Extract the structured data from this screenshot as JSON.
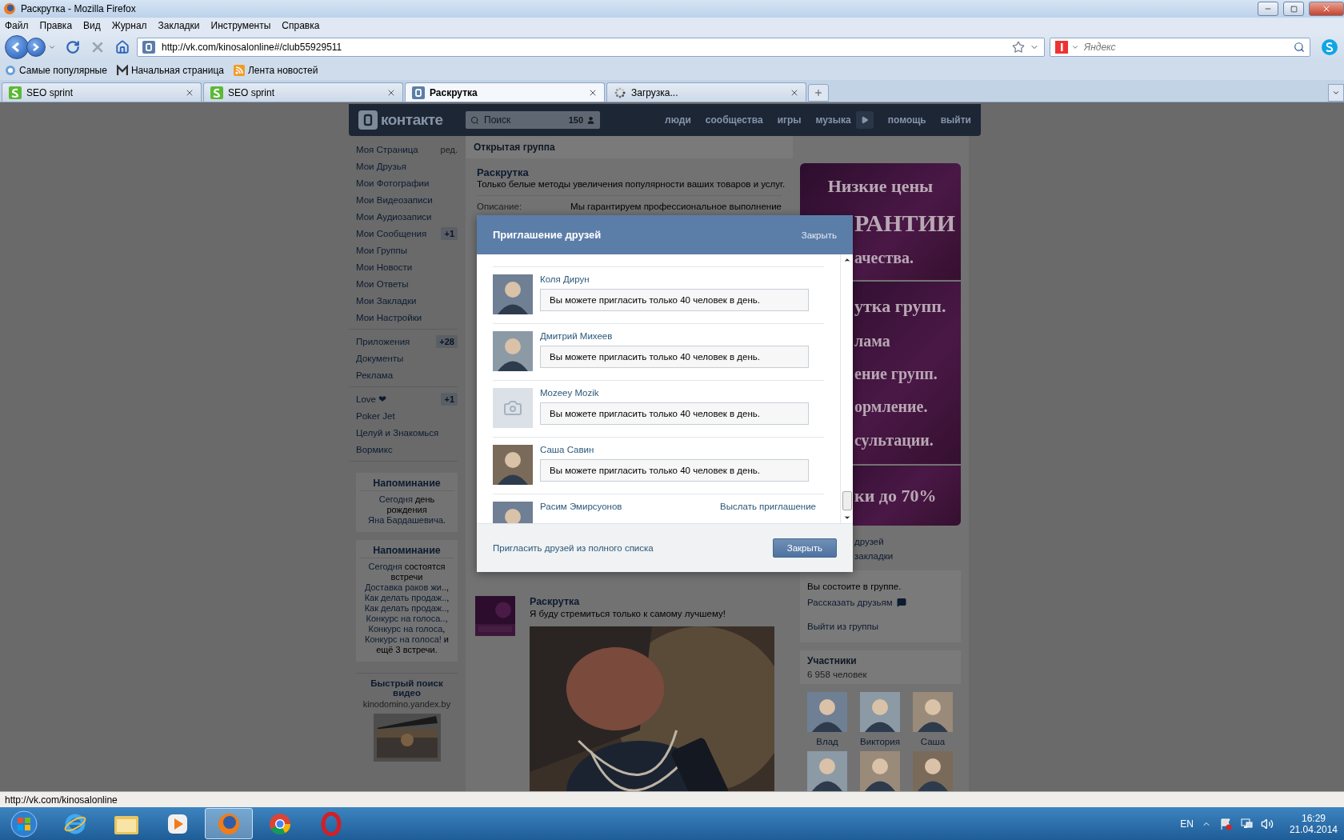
{
  "window": {
    "title": "Раскрутка - Mozilla Firefox"
  },
  "menu": [
    "Файл",
    "Правка",
    "Вид",
    "Журнал",
    "Закладки",
    "Инструменты",
    "Справка"
  ],
  "address": {
    "url": "http://vk.com/kinosalonline#/club55929511"
  },
  "search": {
    "placeholder": "Яндекс"
  },
  "bookmarks": [
    {
      "label": "Самые популярные",
      "kind": "popular"
    },
    {
      "label": "Начальная страница",
      "kind": "home"
    },
    {
      "label": "Лента новостей",
      "kind": "rss"
    }
  ],
  "tabs": [
    {
      "label": "SEO sprint",
      "kind": "seo",
      "selected": false
    },
    {
      "label": "SEO sprint",
      "kind": "seo",
      "selected": false
    },
    {
      "label": "Раскрутка",
      "kind": "vk",
      "selected": true
    },
    {
      "label": "Загрузка...",
      "kind": "loading",
      "selected": false
    }
  ],
  "vk": {
    "logo": "контакте",
    "search": {
      "placeholder": "Поиск",
      "count": "150"
    },
    "nav": [
      {
        "kind": "link",
        "label": "люди"
      },
      {
        "kind": "link",
        "label": "сообщества"
      },
      {
        "kind": "link",
        "label": "игры"
      },
      {
        "kind": "link",
        "label": "музыка"
      },
      {
        "kind": "play"
      },
      {
        "kind": "link",
        "label": "помощь"
      },
      {
        "kind": "link",
        "label": "выйти"
      }
    ]
  },
  "sidebar": {
    "groups": [
      [
        {
          "label": "Моя Страница",
          "extra": "ред."
        },
        {
          "label": "Мои Друзья"
        },
        {
          "label": "Мои Фотографии"
        },
        {
          "label": "Мои Видеозаписи"
        },
        {
          "label": "Мои Аудиозаписи"
        },
        {
          "label": "Мои Сообщения",
          "badge": "+1"
        },
        {
          "label": "Мои Группы"
        },
        {
          "label": "Мои Новости"
        },
        {
          "label": "Мои Ответы"
        },
        {
          "label": "Мои Закладки"
        },
        {
          "label": "Мои Настройки"
        }
      ],
      [
        {
          "label": "Приложения",
          "badge": "+28"
        },
        {
          "label": "Документы"
        },
        {
          "label": "Реклама"
        }
      ],
      [
        {
          "label": "Love ❤",
          "badge": "+1"
        },
        {
          "label": "Poker Jet"
        },
        {
          "label": "Целуй и Знакомься"
        },
        {
          "label": "Вормикс"
        }
      ]
    ],
    "reminders": [
      {
        "title": "Напоминание",
        "segments": [
          {
            "text": "Сегодня",
            "link": true
          },
          {
            "text": " день рождения ",
            "link": false
          },
          {
            "text": "Яна Бардашевича",
            "link": true
          },
          {
            "text": ".",
            "link": false
          }
        ]
      },
      {
        "title": "Напоминание",
        "segments": [
          {
            "text": "Сегодня",
            "link": true
          },
          {
            "text": " состоятся встречи ",
            "link": false
          },
          {
            "text": "Доставка раков жи..",
            "link": true
          },
          {
            "text": ", ",
            "link": false
          },
          {
            "text": "Как делать продаж..",
            "link": true
          },
          {
            "text": ", ",
            "link": false
          },
          {
            "text": "Как делать продаж..",
            "link": true
          },
          {
            "text": ", ",
            "link": false
          },
          {
            "text": "Конкурс на голоса..",
            "link": true
          },
          {
            "text": ", ",
            "link": false
          },
          {
            "text": "Конкурс на голоса",
            "link": true
          },
          {
            "text": ", ",
            "link": false
          },
          {
            "text": "Конкурс на голоса!",
            "link": true
          },
          {
            "text": " и ещё 3 встречи.",
            "link": false
          }
        ]
      }
    ],
    "ad": {
      "title": "Быстрый поиск видео",
      "domain": "kinodomino.yandex.by"
    }
  },
  "group": {
    "type": "Открытая группа",
    "name": "Раскрутка",
    "status": "Только белые методы увеличения популярности ваших товаров и услуг.",
    "info_label": "Описание:",
    "info_value": "Мы гарантируем профессиональное выполнение"
  },
  "post": {
    "author": "Раскрутка",
    "text": "Я буду стремиться только к самому лучшему!"
  },
  "right": {
    "banner": [
      [
        {
          "kind": "title",
          "text": "Низкие цены"
        },
        {
          "kind": "big",
          "text": "РАНТИИ"
        },
        {
          "kind": "line",
          "text": "ачества."
        }
      ],
      [
        {
          "kind": "heading",
          "text": "утка групп."
        },
        {
          "kind": "line",
          "text": "лама"
        },
        {
          "kind": "line",
          "text": "ение групп."
        },
        {
          "kind": "line",
          "text": "ормление."
        },
        {
          "kind": "line",
          "text": "сультации."
        }
      ],
      [
        {
          "kind": "heading",
          "text": "ки до 70%"
        }
      ]
    ],
    "links": [
      "друзей",
      "закладки"
    ],
    "membership": {
      "status": "Вы состоите в группе.",
      "share": "Рассказать друзьям",
      "leave": "Выйти из группы"
    },
    "members": {
      "title": "Участники",
      "count": "6 958 человек",
      "people": [
        "Влад",
        "Виктория",
        "Саша"
      ]
    }
  },
  "modal": {
    "title": "Приглашение друзей",
    "close": "Закрыть",
    "friends": [
      {
        "name": "Коля Дирун",
        "message": "Вы можете пригласить только 40 человек в день."
      },
      {
        "name": "Дмитрий Михеев",
        "message": "Вы можете пригласить только 40 человек в день."
      },
      {
        "name": "Mozeey Mozik",
        "kind": "nophoto",
        "message": "Вы можете пригласить только 40 человек в день."
      },
      {
        "name": "Саша Савин",
        "message": "Вы можете пригласить только 40 человек в день."
      },
      {
        "name": "Расим Эмирсуонов",
        "action": "Выслать приглашение"
      }
    ],
    "full_list": "Пригласить друзей из полного списка",
    "button": "Закрыть"
  },
  "status_bar": "http://vk.com/kinosalonline",
  "taskbar": {
    "apps": [
      {
        "kind": "ie",
        "active": false
      },
      {
        "kind": "folder",
        "active": false
      },
      {
        "kind": "media",
        "active": false
      },
      {
        "kind": "firefox",
        "active": true
      },
      {
        "kind": "chrome",
        "active": false
      },
      {
        "kind": "opera",
        "active": false
      }
    ],
    "language": "EN",
    "time": "16:29",
    "date": "21.04.2014"
  }
}
